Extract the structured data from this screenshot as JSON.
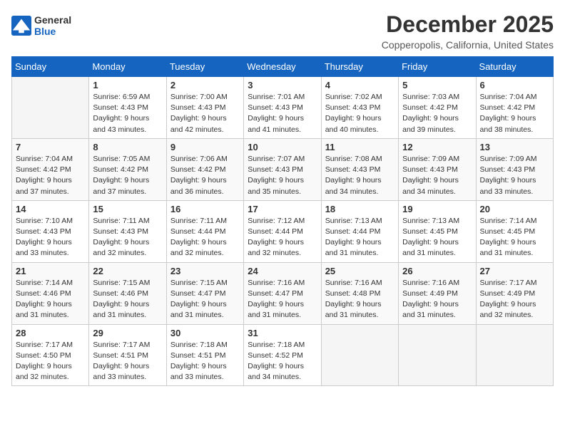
{
  "header": {
    "logo_line1": "General",
    "logo_line2": "Blue",
    "month": "December 2025",
    "location": "Copperopolis, California, United States"
  },
  "weekdays": [
    "Sunday",
    "Monday",
    "Tuesday",
    "Wednesday",
    "Thursday",
    "Friday",
    "Saturday"
  ],
  "weeks": [
    [
      {
        "day": "",
        "sunrise": "",
        "sunset": "",
        "daylight": ""
      },
      {
        "day": "1",
        "sunrise": "Sunrise: 6:59 AM",
        "sunset": "Sunset: 4:43 PM",
        "daylight": "Daylight: 9 hours and 43 minutes."
      },
      {
        "day": "2",
        "sunrise": "Sunrise: 7:00 AM",
        "sunset": "Sunset: 4:43 PM",
        "daylight": "Daylight: 9 hours and 42 minutes."
      },
      {
        "day": "3",
        "sunrise": "Sunrise: 7:01 AM",
        "sunset": "Sunset: 4:43 PM",
        "daylight": "Daylight: 9 hours and 41 minutes."
      },
      {
        "day": "4",
        "sunrise": "Sunrise: 7:02 AM",
        "sunset": "Sunset: 4:43 PM",
        "daylight": "Daylight: 9 hours and 40 minutes."
      },
      {
        "day": "5",
        "sunrise": "Sunrise: 7:03 AM",
        "sunset": "Sunset: 4:42 PM",
        "daylight": "Daylight: 9 hours and 39 minutes."
      },
      {
        "day": "6",
        "sunrise": "Sunrise: 7:04 AM",
        "sunset": "Sunset: 4:42 PM",
        "daylight": "Daylight: 9 hours and 38 minutes."
      }
    ],
    [
      {
        "day": "7",
        "sunrise": "Sunrise: 7:04 AM",
        "sunset": "Sunset: 4:42 PM",
        "daylight": "Daylight: 9 hours and 37 minutes."
      },
      {
        "day": "8",
        "sunrise": "Sunrise: 7:05 AM",
        "sunset": "Sunset: 4:42 PM",
        "daylight": "Daylight: 9 hours and 37 minutes."
      },
      {
        "day": "9",
        "sunrise": "Sunrise: 7:06 AM",
        "sunset": "Sunset: 4:42 PM",
        "daylight": "Daylight: 9 hours and 36 minutes."
      },
      {
        "day": "10",
        "sunrise": "Sunrise: 7:07 AM",
        "sunset": "Sunset: 4:43 PM",
        "daylight": "Daylight: 9 hours and 35 minutes."
      },
      {
        "day": "11",
        "sunrise": "Sunrise: 7:08 AM",
        "sunset": "Sunset: 4:43 PM",
        "daylight": "Daylight: 9 hours and 34 minutes."
      },
      {
        "day": "12",
        "sunrise": "Sunrise: 7:09 AM",
        "sunset": "Sunset: 4:43 PM",
        "daylight": "Daylight: 9 hours and 34 minutes."
      },
      {
        "day": "13",
        "sunrise": "Sunrise: 7:09 AM",
        "sunset": "Sunset: 4:43 PM",
        "daylight": "Daylight: 9 hours and 33 minutes."
      }
    ],
    [
      {
        "day": "14",
        "sunrise": "Sunrise: 7:10 AM",
        "sunset": "Sunset: 4:43 PM",
        "daylight": "Daylight: 9 hours and 33 minutes."
      },
      {
        "day": "15",
        "sunrise": "Sunrise: 7:11 AM",
        "sunset": "Sunset: 4:43 PM",
        "daylight": "Daylight: 9 hours and 32 minutes."
      },
      {
        "day": "16",
        "sunrise": "Sunrise: 7:11 AM",
        "sunset": "Sunset: 4:44 PM",
        "daylight": "Daylight: 9 hours and 32 minutes."
      },
      {
        "day": "17",
        "sunrise": "Sunrise: 7:12 AM",
        "sunset": "Sunset: 4:44 PM",
        "daylight": "Daylight: 9 hours and 32 minutes."
      },
      {
        "day": "18",
        "sunrise": "Sunrise: 7:13 AM",
        "sunset": "Sunset: 4:44 PM",
        "daylight": "Daylight: 9 hours and 31 minutes."
      },
      {
        "day": "19",
        "sunrise": "Sunrise: 7:13 AM",
        "sunset": "Sunset: 4:45 PM",
        "daylight": "Daylight: 9 hours and 31 minutes."
      },
      {
        "day": "20",
        "sunrise": "Sunrise: 7:14 AM",
        "sunset": "Sunset: 4:45 PM",
        "daylight": "Daylight: 9 hours and 31 minutes."
      }
    ],
    [
      {
        "day": "21",
        "sunrise": "Sunrise: 7:14 AM",
        "sunset": "Sunset: 4:46 PM",
        "daylight": "Daylight: 9 hours and 31 minutes."
      },
      {
        "day": "22",
        "sunrise": "Sunrise: 7:15 AM",
        "sunset": "Sunset: 4:46 PM",
        "daylight": "Daylight: 9 hours and 31 minutes."
      },
      {
        "day": "23",
        "sunrise": "Sunrise: 7:15 AM",
        "sunset": "Sunset: 4:47 PM",
        "daylight": "Daylight: 9 hours and 31 minutes."
      },
      {
        "day": "24",
        "sunrise": "Sunrise: 7:16 AM",
        "sunset": "Sunset: 4:47 PM",
        "daylight": "Daylight: 9 hours and 31 minutes."
      },
      {
        "day": "25",
        "sunrise": "Sunrise: 7:16 AM",
        "sunset": "Sunset: 4:48 PM",
        "daylight": "Daylight: 9 hours and 31 minutes."
      },
      {
        "day": "26",
        "sunrise": "Sunrise: 7:16 AM",
        "sunset": "Sunset: 4:49 PM",
        "daylight": "Daylight: 9 hours and 31 minutes."
      },
      {
        "day": "27",
        "sunrise": "Sunrise: 7:17 AM",
        "sunset": "Sunset: 4:49 PM",
        "daylight": "Daylight: 9 hours and 32 minutes."
      }
    ],
    [
      {
        "day": "28",
        "sunrise": "Sunrise: 7:17 AM",
        "sunset": "Sunset: 4:50 PM",
        "daylight": "Daylight: 9 hours and 32 minutes."
      },
      {
        "day": "29",
        "sunrise": "Sunrise: 7:17 AM",
        "sunset": "Sunset: 4:51 PM",
        "daylight": "Daylight: 9 hours and 33 minutes."
      },
      {
        "day": "30",
        "sunrise": "Sunrise: 7:18 AM",
        "sunset": "Sunset: 4:51 PM",
        "daylight": "Daylight: 9 hours and 33 minutes."
      },
      {
        "day": "31",
        "sunrise": "Sunrise: 7:18 AM",
        "sunset": "Sunset: 4:52 PM",
        "daylight": "Daylight: 9 hours and 34 minutes."
      },
      {
        "day": "",
        "sunrise": "",
        "sunset": "",
        "daylight": ""
      },
      {
        "day": "",
        "sunrise": "",
        "sunset": "",
        "daylight": ""
      },
      {
        "day": "",
        "sunrise": "",
        "sunset": "",
        "daylight": ""
      }
    ]
  ]
}
